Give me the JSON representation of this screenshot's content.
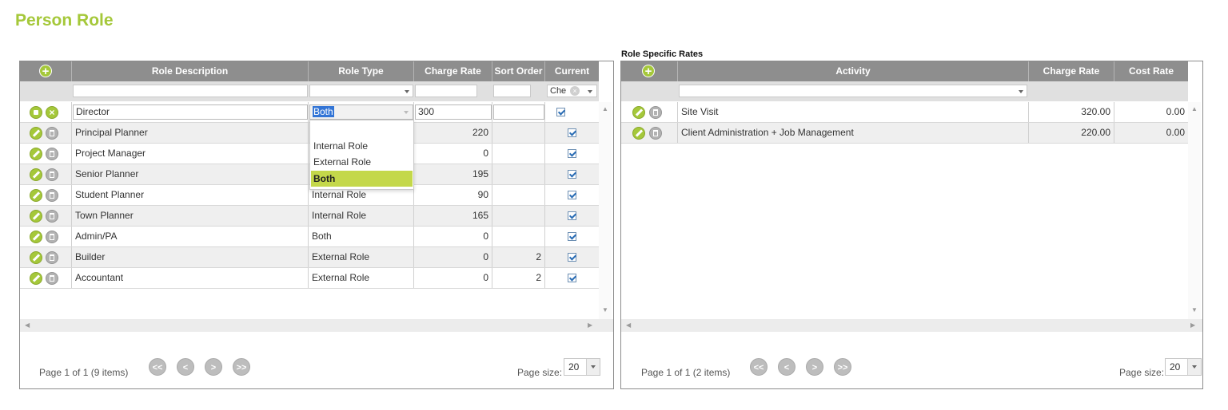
{
  "page": {
    "title": "Person Role",
    "rates_title": "Role Specific Rates"
  },
  "roles_grid": {
    "columns": [
      "Role Description",
      "Role Type",
      "Charge Rate",
      "Sort Order",
      "Current"
    ],
    "filter_current_value": "Che",
    "editing_row": {
      "description": "Director",
      "role_type": "Both",
      "charge_rate": "300",
      "sort_order": "",
      "current": true
    },
    "rows": [
      {
        "description": "Principal Planner",
        "role_type": "",
        "charge_rate": "220",
        "sort_order": "",
        "current": true
      },
      {
        "description": "Project Manager",
        "role_type": "",
        "charge_rate": "0",
        "sort_order": "",
        "current": true
      },
      {
        "description": "Senior Planner",
        "role_type": "",
        "charge_rate": "195",
        "sort_order": "",
        "current": true
      },
      {
        "description": "Student Planner",
        "role_type": "Internal Role",
        "charge_rate": "90",
        "sort_order": "",
        "current": true
      },
      {
        "description": "Town Planner",
        "role_type": "Internal Role",
        "charge_rate": "165",
        "sort_order": "",
        "current": true
      },
      {
        "description": "Admin/PA",
        "role_type": "Both",
        "charge_rate": "0",
        "sort_order": "",
        "current": true
      },
      {
        "description": "Builder",
        "role_type": "External Role",
        "charge_rate": "0",
        "sort_order": "2",
        "current": true
      },
      {
        "description": "Accountant",
        "role_type": "External Role",
        "charge_rate": "0",
        "sort_order": "2",
        "current": true
      }
    ],
    "pager": {
      "info": "Page 1 of 1 (9 items)",
      "page_size_label": "Page size:",
      "page_size": "20"
    }
  },
  "role_type_dropdown": {
    "options": [
      "Internal Role",
      "External Role",
      "Both"
    ],
    "selected": "Both"
  },
  "rates_grid": {
    "columns": [
      "Activity",
      "Charge Rate",
      "Cost Rate"
    ],
    "rows": [
      {
        "activity": "Site Visit",
        "charge_rate": "320.00",
        "cost_rate": "0.00"
      },
      {
        "activity": "Client Administration + Job Management",
        "charge_rate": "220.00",
        "cost_rate": "0.00"
      }
    ],
    "pager": {
      "info": "Page 1 of 1 (2 items)",
      "page_size_label": "Page size:",
      "page_size": "20"
    }
  },
  "pager_buttons": {
    "first": "<<",
    "prev": "<",
    "next": ">",
    "last": ">>"
  },
  "icons": {
    "add": "+",
    "cancel": "×"
  },
  "colors": {
    "accent": "#a5c83a",
    "header": "#8e8e8e",
    "selected": "#c4d84a"
  }
}
